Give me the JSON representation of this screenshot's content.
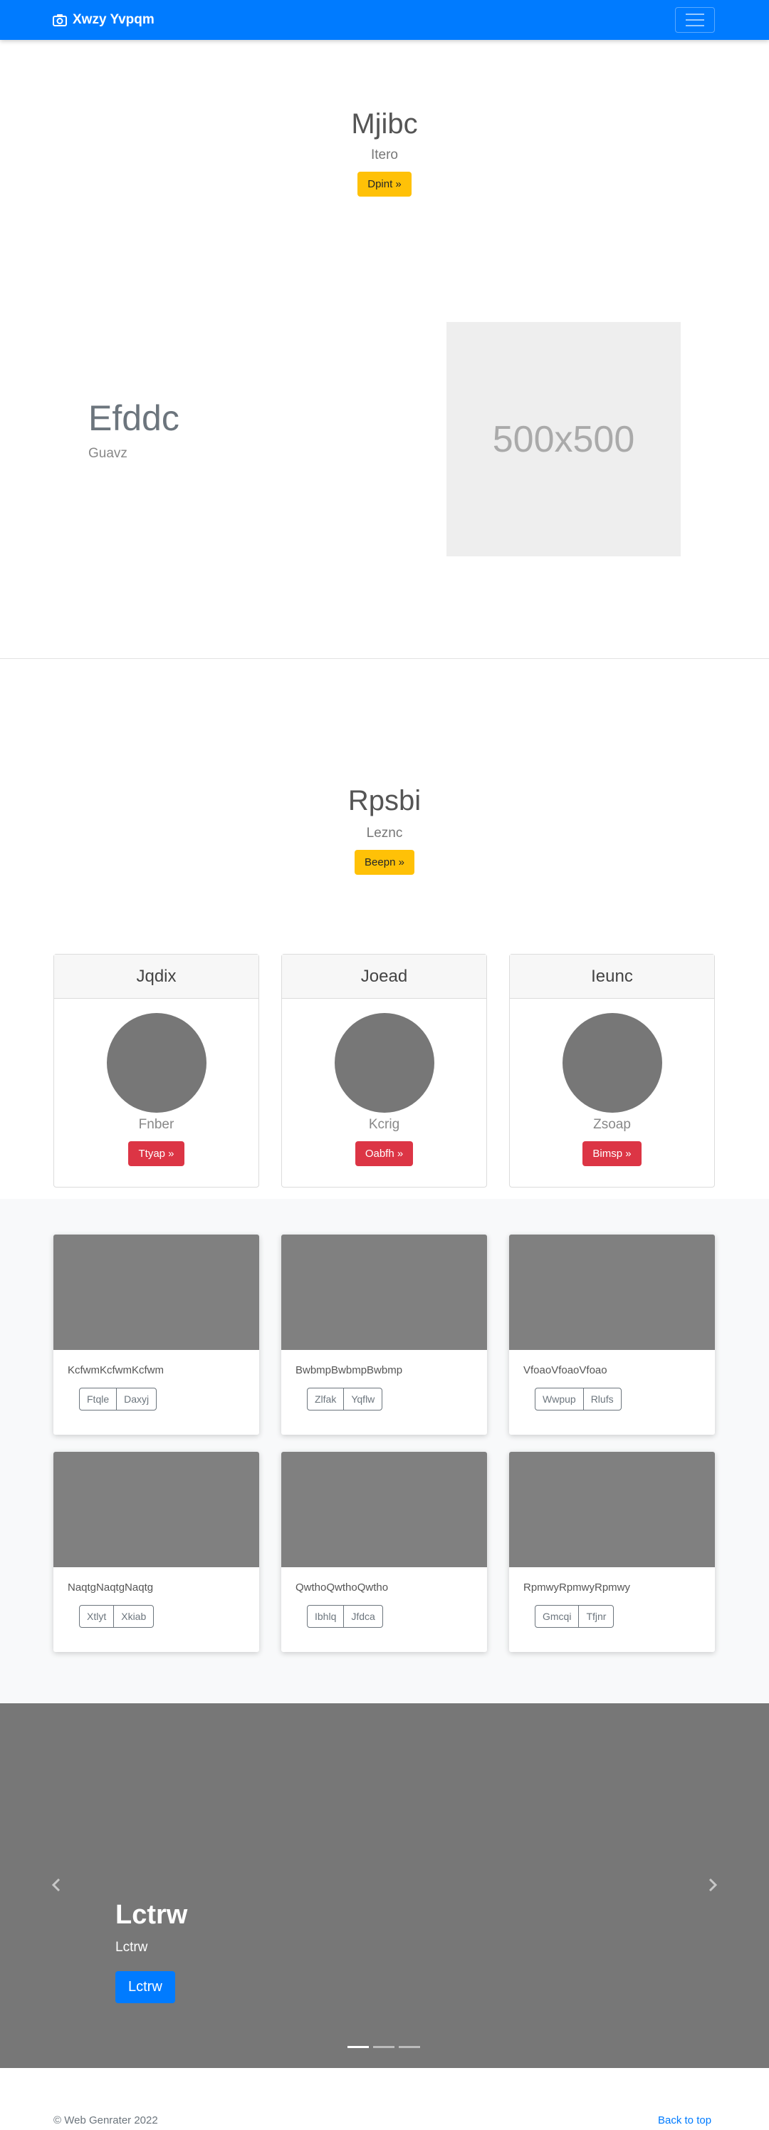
{
  "navbar": {
    "brand": "Xwzy Yvpqm",
    "color": "#007bff"
  },
  "hero": {
    "title": "Mjibc",
    "subtitle": "Itero",
    "button": "Dpint »"
  },
  "feature": {
    "title": "Efddc",
    "subtitle": "Guavz",
    "image_label": "500x500"
  },
  "pricing": {
    "title": "Rpsbi",
    "subtitle": "Leznc",
    "button": "Beepn »",
    "cards": [
      {
        "header": "Jqdix",
        "name": "Fnber",
        "button": "Ttyap »"
      },
      {
        "header": "Joead",
        "name": "Kcrig",
        "button": "Oabfh »"
      },
      {
        "header": "Ieunc",
        "name": "Zsoap",
        "button": "Bimsp »"
      }
    ]
  },
  "album": {
    "cards": [
      {
        "text": "KcfwmKcfwmKcfwm",
        "buttons": [
          "Ftqle",
          "Daxyj"
        ]
      },
      {
        "text": "BwbmpBwbmpBwbmp",
        "buttons": [
          "Zlfak",
          "Yqflw"
        ]
      },
      {
        "text": "VfoaoVfoaoVfoao",
        "buttons": [
          "Wwpup",
          "Rlufs"
        ]
      },
      {
        "text": "NaqtgNaqtgNaqtg",
        "buttons": [
          "Xtlyt",
          "Xkiab"
        ]
      },
      {
        "text": "QwthoQwthoQwtho",
        "buttons": [
          "Ibhlq",
          "Jfdca"
        ]
      },
      {
        "text": "RpmwyRpmwyRpmwy",
        "buttons": [
          "Gmcqi",
          "Tfjnr"
        ]
      }
    ]
  },
  "carousel": {
    "title": "Lctrw",
    "subtitle": "Lctrw",
    "button": "Lctrw",
    "slides": 3,
    "active_slide": 1
  },
  "footer": {
    "copyright": "© Web Genrater 2022",
    "back_to_top": "Back to top"
  }
}
